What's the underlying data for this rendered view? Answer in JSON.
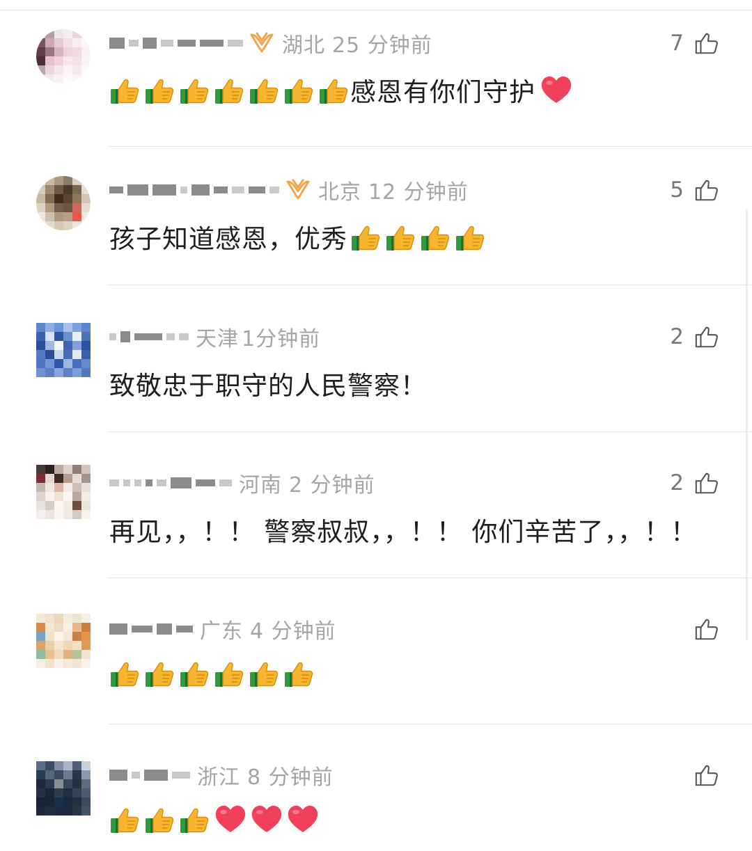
{
  "comments": [
    {
      "region": "湖北",
      "time": "25 分钟前",
      "likes": "7",
      "text_before": "",
      "text_after": "感恩有你们守护",
      "emoji_before": [],
      "emoji_after": [
        "thumbs-up",
        "thumbs-up",
        "thumbs-up",
        "thumbs-up",
        "thumbs-up",
        "thumbs-up",
        "thumbs-up"
      ],
      "trailing_hearts": 1,
      "vip": true
    },
    {
      "region": "北京",
      "time": "12 分钟前",
      "likes": "5",
      "text": "孩子知道感恩，优秀",
      "thumbs": 4,
      "vip": true
    },
    {
      "region": "天津",
      "time": "1分钟前",
      "likes": "2",
      "text": "致敬忠于职守的人民警察！",
      "vip": false
    },
    {
      "region": "河南",
      "time": "2 分钟前",
      "likes": "2",
      "text": "再见，，！！ 警察叔叔，，！！ 你们辛苦了，，！！",
      "vip": false
    },
    {
      "region": "广东",
      "time": "4 分钟前",
      "likes": "",
      "thumbs": 6,
      "vip": false
    },
    {
      "region": "浙江",
      "time": "8 分钟前",
      "likes": "",
      "thumbs": 3,
      "hearts": 3,
      "vip": false
    }
  ],
  "icons": {
    "like": "thumbs-up-outline-icon",
    "vip": "vip-badge-icon",
    "emoji_thumb": "thumbs-up-emoji",
    "emoji_heart": "red-heart-emoji"
  },
  "colors": {
    "meta": "#a5a5a5",
    "vip": "#f2a54a",
    "heart": "#f0405a"
  }
}
